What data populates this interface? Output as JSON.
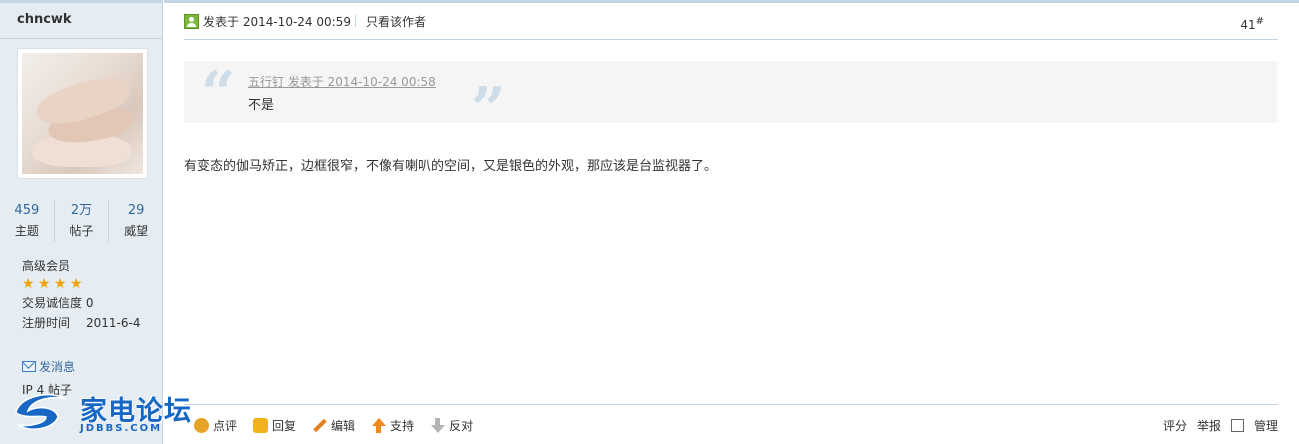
{
  "author": {
    "username": "chncwk",
    "stats": [
      {
        "value": "459",
        "label": "主题"
      },
      {
        "value": "2万",
        "label": "帖子"
      },
      {
        "value": "29",
        "label": "威望"
      }
    ],
    "group": "高级会员",
    "stars": 4,
    "trust_label": "交易诚信度 0",
    "register_label": "注册时间",
    "register_date": "2011-6-4",
    "send_message": "发消息",
    "ip_line": "IP 4  帖子"
  },
  "logo": {
    "text": "家电论坛",
    "sub": "JDBBS.COM"
  },
  "post": {
    "posted_at": "发表于 2014-10-24 00:59",
    "only_author": "只看该作者",
    "floor": "41",
    "floor_mark": "#",
    "quote_meta": "五行钉 发表于 2014-10-24 00:58",
    "quote_text": "不是",
    "body": "有变态的伽马矫正，边框很窄，不像有喇叭的空间，又是银色的外观，那应该是台监视器了。"
  },
  "actions": {
    "review": "点评",
    "reply": "回复",
    "edit": "编辑",
    "support": "支持",
    "oppose": "反对",
    "rate": "评分",
    "report": "举报",
    "manage": "管理"
  },
  "colors": {
    "sidebar_bg": "#e5edf2",
    "border": "#c2d5e3",
    "link": "#336699",
    "brand": "#1767c4"
  }
}
